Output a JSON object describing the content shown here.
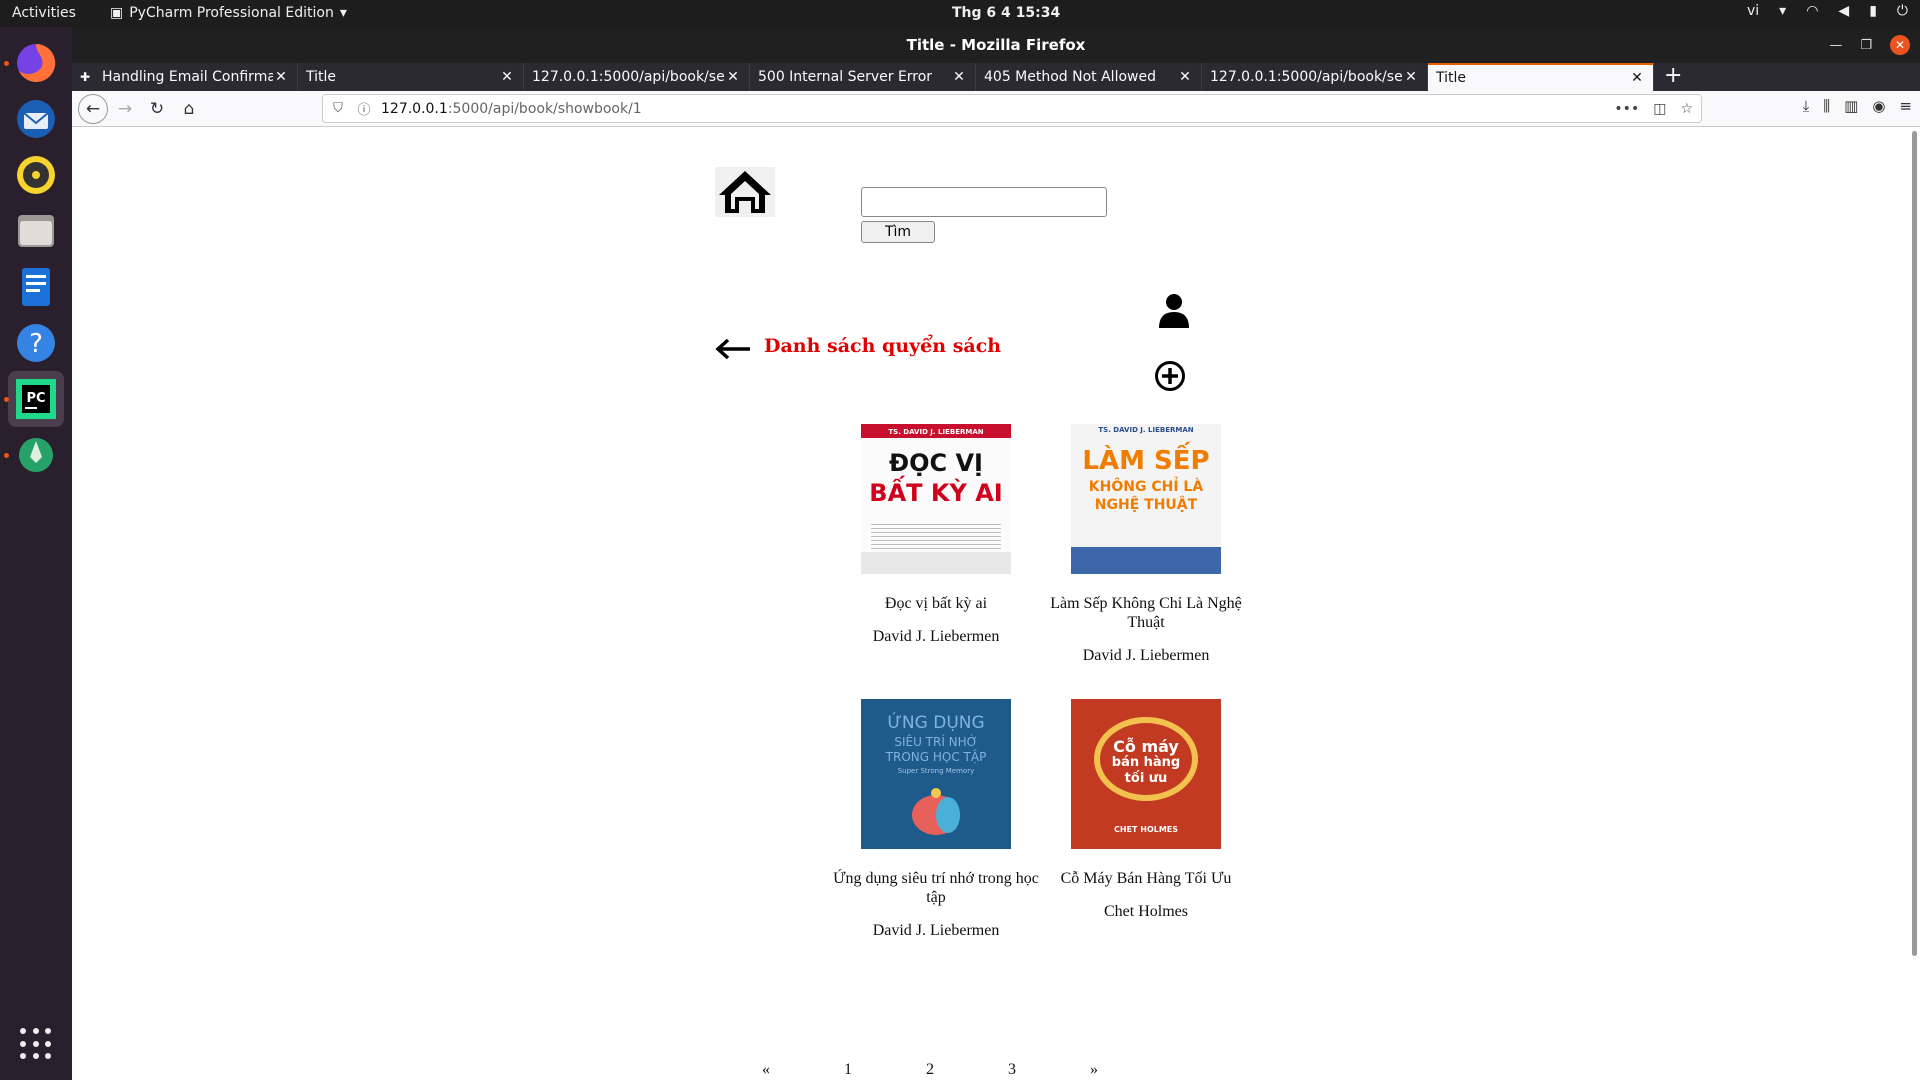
{
  "topbar": {
    "activities": "Activities",
    "app_menu": "PyCharm Professional Edition",
    "clock": "Thg 6 4  15:34",
    "lang": "vi"
  },
  "window": {
    "title": "Title - Mozilla Firefox"
  },
  "tabs": [
    {
      "label": "Handling Email Confirma",
      "selected": false
    },
    {
      "label": "Title",
      "selected": false
    },
    {
      "label": "127.0.0.1:5000/api/book/se",
      "selected": false
    },
    {
      "label": "500 Internal Server Error",
      "selected": false
    },
    {
      "label": "405 Method Not Allowed",
      "selected": false
    },
    {
      "label": "127.0.0.1:5000/api/book/se",
      "selected": false
    },
    {
      "label": "Title",
      "selected": true
    }
  ],
  "url": {
    "host": "127.0.0.1",
    "path": ":5000/api/book/showbook/1"
  },
  "page": {
    "search_button": "Tìm",
    "search_value": "",
    "list_title": "Danh sách quyển sách"
  },
  "books": [
    {
      "title": "Đọc vị bất kỳ ai",
      "author": "David J. Liebermen",
      "cover_line1": "ĐỌC VỊ",
      "cover_line2": "BẤT KỲ AI",
      "cover_top": "TS. DAVID J. LIEBERMAN"
    },
    {
      "title": "Làm Sếp Không Chỉ Là Nghệ Thuật",
      "author": "David J. Liebermen",
      "cover_line1": "LÀM SẾP",
      "cover_line2": "KHÔNG CHỈ LÀ NGHỆ THUẬT",
      "cover_top": "TS. DAVID J. LIEBERMAN"
    },
    {
      "title": "Ứng dụng siêu trí nhớ trong học tập",
      "author": "David J. Liebermen",
      "cover_line1": "ỨNG DỤNG",
      "cover_line2": "SIÊU TRÍ NHỚ TRONG HỌC TẬP",
      "cover_top": "Super Strong Memory"
    },
    {
      "title": "Cỗ Máy Bán Hàng Tối Ưu",
      "author": "Chet Holmes",
      "cover_line1": "Cỗ máy",
      "cover_line2": "bán hàng tối ưu",
      "cover_top": "CHET HOLMES"
    }
  ],
  "pagination": [
    "«",
    "1",
    "2",
    "3",
    "»"
  ],
  "colors": {
    "accent_tab": "#e66000",
    "title_red": "#e00000",
    "dock_bg": "#2a1f2d"
  }
}
